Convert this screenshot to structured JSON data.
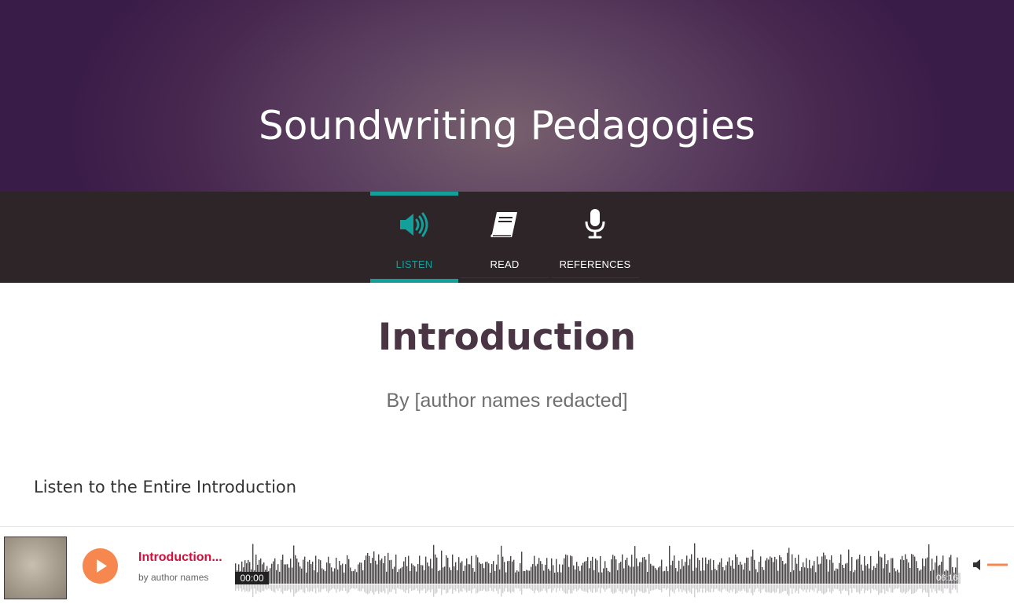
{
  "site": {
    "title": "Soundwriting Pedagogies"
  },
  "nav": {
    "tabs": [
      {
        "label": "LISTEN",
        "icon": "speaker-icon",
        "active": true
      },
      {
        "label": "READ",
        "icon": "book-icon",
        "active": false
      },
      {
        "label": "REFERENCES",
        "icon": "microphone-icon",
        "active": false
      }
    ]
  },
  "main": {
    "title": "Introduction",
    "byline": "By [author names redacted]",
    "listen_heading": "Listen to the Entire Introduction"
  },
  "player": {
    "track_title": "Introduction...",
    "track_author": "by author names",
    "time_current": "00:00",
    "time_total": "06:16",
    "progress": 0.0
  },
  "colors": {
    "accent": "#13a09a",
    "hero_purple": "#48284f",
    "nav_bg": "#2d2528",
    "play_orange": "#f5874f",
    "track_title_red": "#d0103a"
  }
}
